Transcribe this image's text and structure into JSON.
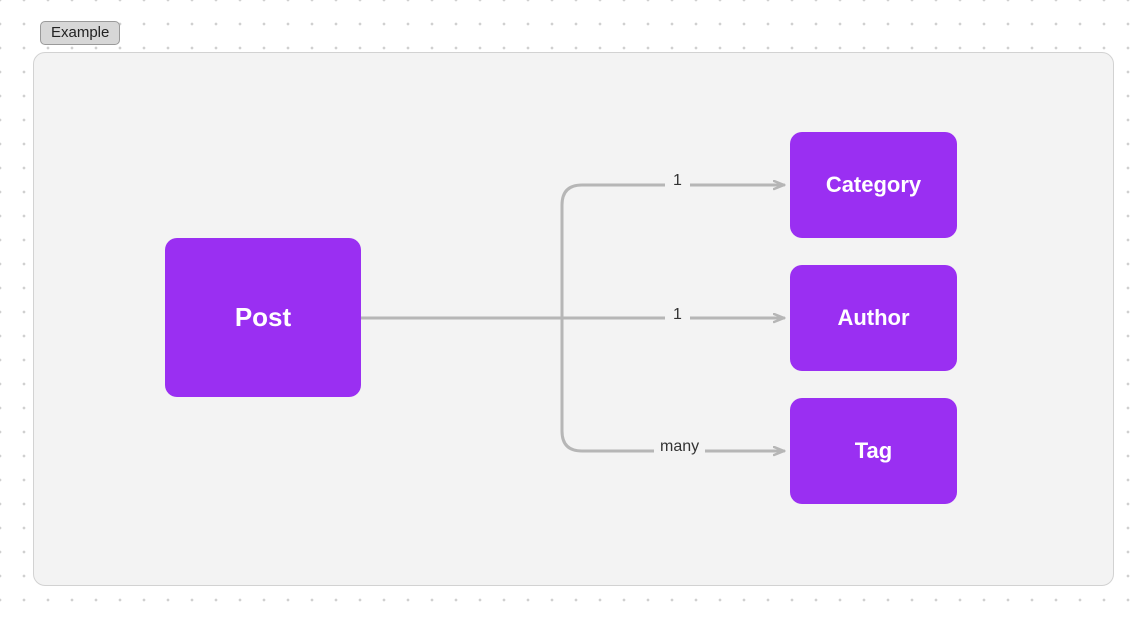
{
  "badge": {
    "label": "Example"
  },
  "entities": {
    "post": {
      "label": "Post"
    },
    "category": {
      "label": "Category"
    },
    "author": {
      "label": "Author"
    },
    "tag": {
      "label": "Tag"
    }
  },
  "relations": {
    "post_category": {
      "cardinality": "1"
    },
    "post_author": {
      "cardinality": "1"
    },
    "post_tag": {
      "cardinality": "many"
    }
  },
  "colors": {
    "node_bg": "#9a2ff2",
    "node_fg": "#ffffff",
    "edge": "#b6b6b6",
    "frame_bg": "#f3f3f3",
    "frame_border": "#d2d2d2"
  }
}
